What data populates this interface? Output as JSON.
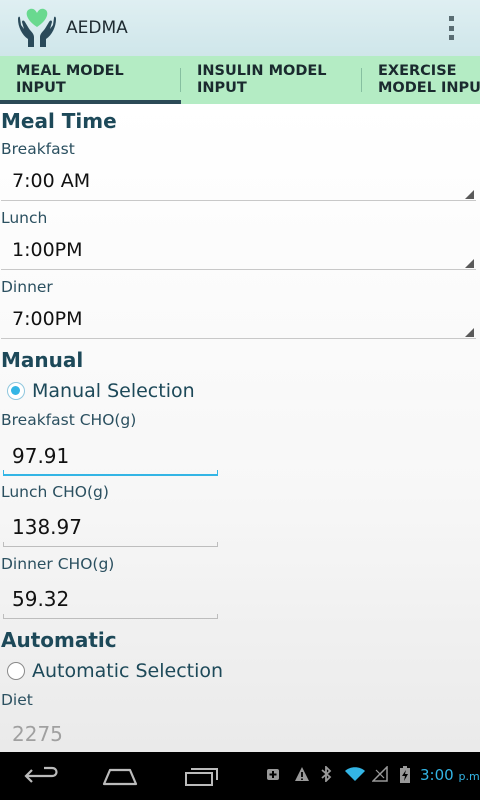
{
  "app": {
    "title": "AEDMA"
  },
  "tabs": [
    {
      "label": "MEAL MODEL INPUT",
      "selected": true
    },
    {
      "label": "INSULIN MODEL INPUT",
      "selected": false
    },
    {
      "label": "EXERCISE MODEL INPUT",
      "selected": false
    }
  ],
  "meal_time": {
    "header": "Meal Time",
    "breakfast": {
      "label": "Breakfast",
      "value": "7:00 AM"
    },
    "lunch": {
      "label": "Lunch",
      "value": "1:00PM"
    },
    "dinner": {
      "label": "Dinner",
      "value": "7:00PM"
    }
  },
  "manual": {
    "header": "Manual",
    "radio_label": "Manual Selection",
    "radio_checked": true,
    "breakfast_cho": {
      "label": "Breakfast CHO(g)",
      "value": "97.91"
    },
    "lunch_cho": {
      "label": "Lunch CHO(g)",
      "value": "138.97"
    },
    "dinner_cho": {
      "label": "Dinner CHO(g)",
      "value": "59.32"
    }
  },
  "automatic": {
    "header": "Automatic",
    "radio_label": "Automatic Selection",
    "radio_checked": false,
    "diet": {
      "label": "Diet",
      "hint": "2275"
    }
  },
  "status_bar": {
    "time": "3:00",
    "ampm": "p.m.",
    "icons": [
      "notification-icon",
      "warning-icon",
      "bluetooth-icon",
      "wifi-icon",
      "no-signal-icon",
      "battery-charging-icon"
    ]
  },
  "colors": {
    "tab_bar": "#b4ecc4",
    "header_text": "#1d4959",
    "accent": "#33b5e5",
    "action_bar": "#d4e9ec"
  }
}
